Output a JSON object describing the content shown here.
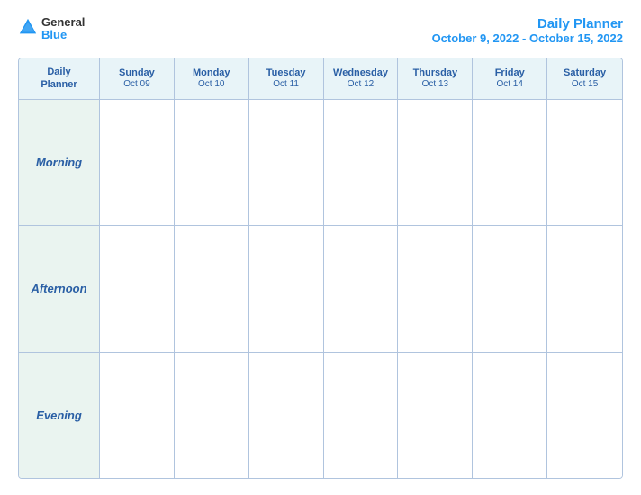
{
  "header": {
    "logo": {
      "general": "General",
      "blue": "Blue"
    },
    "title": "Daily Planner",
    "subtitle": "October 9, 2022 - October 15, 2022"
  },
  "calendar": {
    "header_label_line1": "Daily",
    "header_label_line2": "Planner",
    "columns": [
      {
        "day": "Sunday",
        "date": "Oct 09"
      },
      {
        "day": "Monday",
        "date": "Oct 10"
      },
      {
        "day": "Tuesday",
        "date": "Oct 11"
      },
      {
        "day": "Wednesday",
        "date": "Oct 12"
      },
      {
        "day": "Thursday",
        "date": "Oct 13"
      },
      {
        "day": "Friday",
        "date": "Oct 14"
      },
      {
        "day": "Saturday",
        "date": "Oct 15"
      }
    ],
    "rows": [
      {
        "label": "Morning"
      },
      {
        "label": "Afternoon"
      },
      {
        "label": "Evening"
      }
    ]
  }
}
